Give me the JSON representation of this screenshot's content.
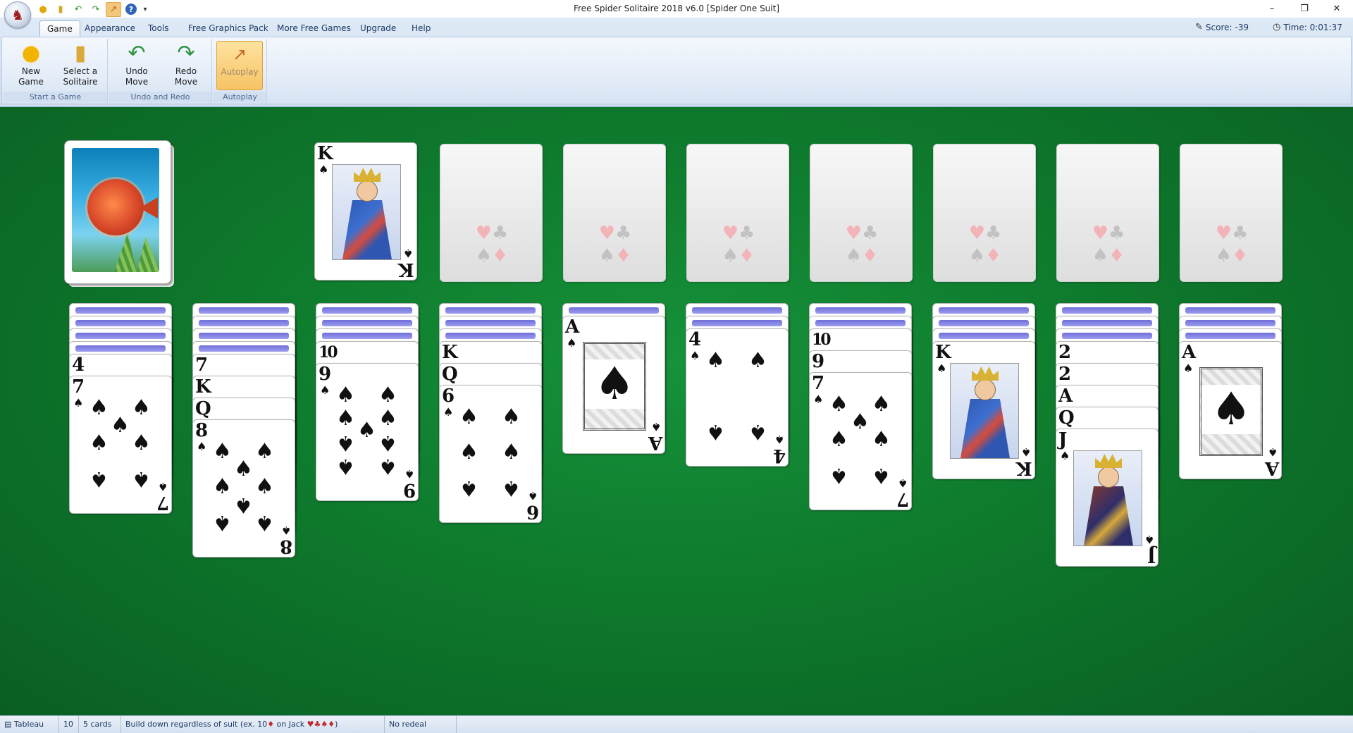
{
  "window": {
    "title": "Free Spider Solitaire 2018 v6.0  [Spider One Suit]",
    "minimize": "–",
    "restore": "❐",
    "close": "✕"
  },
  "qat": [
    "sun-icon",
    "book-icon",
    "undo-icon",
    "redo-icon",
    "autoplay-icon",
    "help-icon"
  ],
  "tabs": [
    "Game",
    "Appearance",
    "Tools",
    "Free Graphics Pack",
    "More Free Games",
    "Upgrade",
    "Help"
  ],
  "selected_tab": "Game",
  "status": {
    "score": "Score: -39",
    "time": "Time: 0:01:37"
  },
  "ribbon": {
    "groups": [
      {
        "label": "Start a Game",
        "buttons": [
          {
            "line1": "New",
            "line2": "Game"
          },
          {
            "line1": "Select a",
            "line2": "Solitaire"
          }
        ]
      },
      {
        "label": "Undo and Redo",
        "buttons": [
          {
            "line1": "Undo",
            "line2": "Move"
          },
          {
            "line1": "Redo",
            "line2": "Move"
          }
        ]
      },
      {
        "label": "Autoplay",
        "buttons": [
          {
            "line1": "Autoplay",
            "line2": ""
          }
        ]
      }
    ]
  },
  "board": {
    "foundation_completed": {
      "rank": "K",
      "suit": "♠"
    },
    "empty_foundation_suits": [
      "♥",
      "♣",
      "♠",
      "♦"
    ],
    "columns": [
      {
        "face_down": 4,
        "up": [
          "4",
          "7"
        ]
      },
      {
        "face_down": 4,
        "up": [
          "7",
          "K",
          "Q",
          "8"
        ]
      },
      {
        "face_down": 3,
        "up": [
          "10",
          "9"
        ]
      },
      {
        "face_down": 3,
        "up": [
          "K",
          "Q",
          "6"
        ]
      },
      {
        "face_down": 1,
        "up": [
          "A"
        ]
      },
      {
        "face_down": 2,
        "up": [
          "4"
        ]
      },
      {
        "face_down": 2,
        "up": [
          "10",
          "9",
          "7"
        ]
      },
      {
        "face_down": 3,
        "up": [
          "K"
        ]
      },
      {
        "face_down": 3,
        "up": [
          "2",
          "2",
          "A",
          "Q",
          "J"
        ]
      },
      {
        "face_down": 3,
        "up": [
          "A"
        ]
      }
    ],
    "suit": "♠"
  },
  "statusbar": {
    "area": "Tableau",
    "columns": "10",
    "cards": "5 cards",
    "rule_prefix": "Build down regardless of suit (ex. 10",
    "rule_diamond": "♦",
    "rule_mid": " on Jack ",
    "rule_suits": "♥♣♠♦",
    "rule_suffix": ")",
    "redeal": "No redeal"
  }
}
